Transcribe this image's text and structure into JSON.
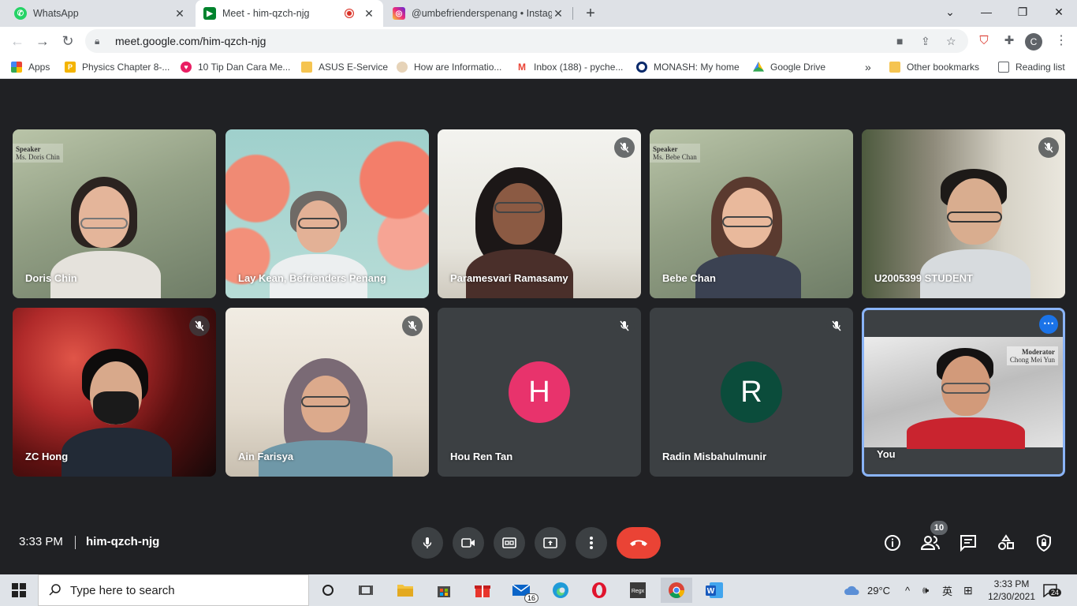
{
  "browser": {
    "tabs": [
      {
        "title": "WhatsApp",
        "active": false
      },
      {
        "title": "Meet - him-qzch-njg",
        "active": true,
        "recording": true
      },
      {
        "title": "@umbefrienderspenang • Instag",
        "active": false
      }
    ],
    "url": "meet.google.com/him-qzch-njg",
    "profile_initial": "C",
    "bookmarks": [
      "Apps",
      "Physics Chapter 8-...",
      "10 Tip Dan Cara Me...",
      "ASUS E-Service",
      "How are Informatio...",
      "Inbox (188) - pyche...",
      "MONASH: My home",
      "Google Drive"
    ],
    "more_bookmarks": "»",
    "other_bookmarks": "Other bookmarks",
    "reading_list": "Reading list"
  },
  "meet": {
    "participants": [
      {
        "name": "Doris Chin",
        "muted": false,
        "sign_title": "Speaker",
        "sign_name": "Ms. Doris Chin"
      },
      {
        "name": "Lay Kean, Befrienders Penang",
        "muted": false
      },
      {
        "name": "Paramesvari Ramasamy",
        "muted": true
      },
      {
        "name": "Bebe Chan",
        "muted": false,
        "sign_title": "Speaker",
        "sign_name": "Ms. Bebe Chan"
      },
      {
        "name": "U2005399 STUDENT",
        "muted": true
      },
      {
        "name": "ZC Hong",
        "muted": true
      },
      {
        "name": "Ain Farisya",
        "muted": true
      },
      {
        "name": "Hou Ren Tan",
        "muted": true,
        "initial": "H",
        "color": "#e8336c"
      },
      {
        "name": "Radin Misbahulmunir",
        "muted": true,
        "initial": "R",
        "color": "#0b4c3b"
      },
      {
        "name": "You",
        "muted": false,
        "sign_title": "Moderator",
        "sign_name": "Chong Mei Yun"
      }
    ],
    "time": "3:33 PM",
    "meeting_code": "him-qzch-njg",
    "people_count": "10",
    "colors": {
      "end_call": "#ea4335",
      "background": "#202124",
      "self_border": "#8ab4f8"
    }
  },
  "taskbar": {
    "search_placeholder": "Type here to search",
    "mail_badge": "16",
    "weather": "29°C",
    "ime": "英",
    "clock_time": "3:33 PM",
    "clock_date": "12/30/2021",
    "notifications": "24"
  }
}
